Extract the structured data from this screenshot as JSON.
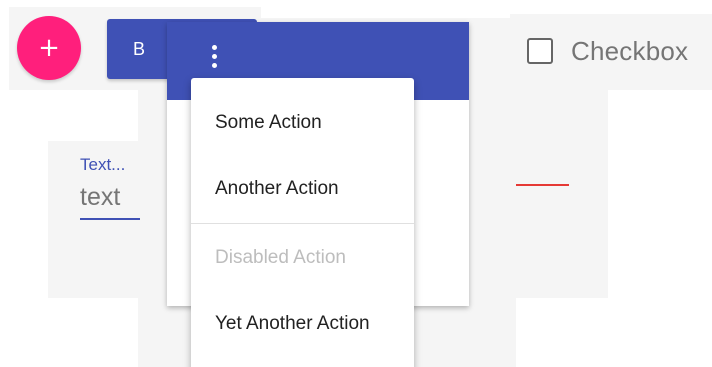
{
  "fab": {
    "icon": "plus-icon",
    "glyph": "+",
    "color": "#ff1f7c"
  },
  "raised_button": {
    "visible_label": "B",
    "color": "#3f51b5"
  },
  "checkbox": {
    "label": "Checkbox",
    "checked": false
  },
  "textfield": {
    "label": "Text...",
    "value": "text",
    "accent": "#3f51b5"
  },
  "menu": {
    "toolbar_color": "#3f51b5",
    "trigger_icon": "more-vert-icon",
    "items": [
      {
        "label": "Some Action",
        "disabled": false
      },
      {
        "label": "Another Action",
        "disabled": false
      },
      {
        "label": "Disabled Action",
        "disabled": true
      },
      {
        "label": "Yet Another Action",
        "disabled": false
      }
    ]
  },
  "colors": {
    "error_rule": "#e53935",
    "disabled_text": "#bdbdbd"
  }
}
